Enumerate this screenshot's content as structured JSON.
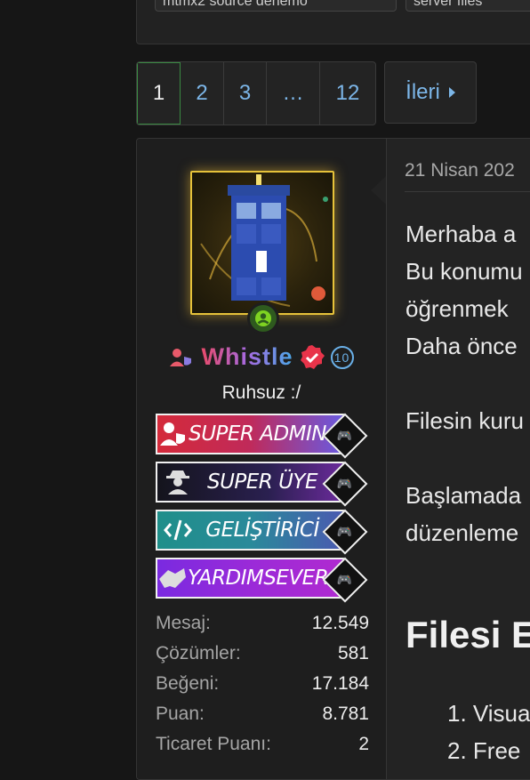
{
  "top_tags": [
    "mtmx2 source denemo",
    "server files"
  ],
  "pagination": {
    "pages": [
      "1",
      "2",
      "3",
      "…",
      "12"
    ],
    "current": "1",
    "next_label": "İleri"
  },
  "post": {
    "user": {
      "name": "Whistle",
      "level": "10",
      "title": "Ruhsuz :/",
      "banners": [
        {
          "label": "SUPER ADMIN",
          "color_start": "#d42a3a",
          "color_end": "#6a5ae0"
        },
        {
          "label": "SUPER ÜYE",
          "color_start": "#1a1a22",
          "color_end": "#6a2a9a"
        },
        {
          "label": "GELİŞTİRİCİ",
          "color_start": "#1f8f8a",
          "color_end": "#4a5ab0"
        },
        {
          "label": "YARDIMSEVER",
          "color_start": "#7a2ae0",
          "color_end": "#b02ad0"
        }
      ],
      "stats": [
        {
          "label": "Mesaj:",
          "value": "12.549"
        },
        {
          "label": "Çözümler:",
          "value": "581"
        },
        {
          "label": "Beğeni:",
          "value": "17.184"
        },
        {
          "label": "Puan:",
          "value": "8.781"
        },
        {
          "label": "Ticaret Puanı:",
          "value": "2"
        }
      ]
    },
    "date": "21 Nisan 202",
    "body_lines": [
      "Merhaba a",
      "Bu konumu",
      "öğrenmek",
      "Daha önce",
      "",
      "Filesin kuru",
      "",
      "Başlamada",
      "düzenleme"
    ],
    "heading": "Filesi E",
    "list_items": [
      "1. Visua",
      "2. Free"
    ]
  },
  "colors": {
    "accent_blue": "#7cb6e8",
    "current_page_border": "#3a8a42",
    "online_green": "#7ed321",
    "verified_red": "#e8344a"
  }
}
